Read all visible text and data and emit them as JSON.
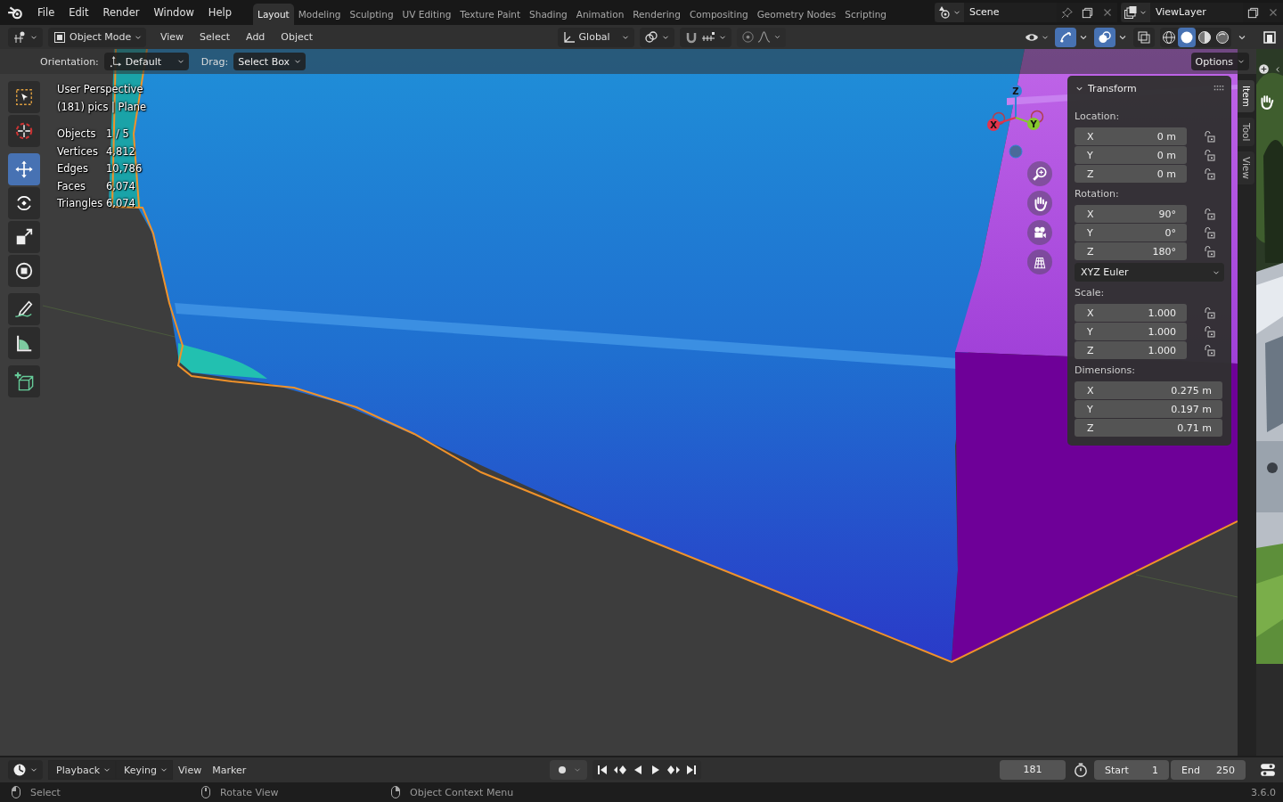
{
  "top_bar": {
    "menus": [
      "File",
      "Edit",
      "Render",
      "Window",
      "Help"
    ],
    "workspaces": [
      {
        "label": "Layout",
        "selected": true
      },
      {
        "label": "Modeling",
        "selected": false
      },
      {
        "label": "Sculpting",
        "selected": false
      },
      {
        "label": "UV Editing",
        "selected": false
      },
      {
        "label": "Texture Paint",
        "selected": false
      },
      {
        "label": "Shading",
        "selected": false
      },
      {
        "label": "Animation",
        "selected": false
      },
      {
        "label": "Rendering",
        "selected": false
      },
      {
        "label": "Compositing",
        "selected": false
      },
      {
        "label": "Geometry Nodes",
        "selected": false
      },
      {
        "label": "Scripting",
        "selected": false
      }
    ],
    "scene": "Scene",
    "view_layer": "ViewLayer"
  },
  "viewport_header": {
    "mode": "Object Mode",
    "menus": [
      "View",
      "Select",
      "Add",
      "Object"
    ],
    "transform_orientation": "Global",
    "toggles": [
      {
        "kind": "gizmos",
        "on": true
      },
      {
        "kind": "overlays",
        "on": true
      },
      {
        "kind": "xray",
        "on": false
      }
    ],
    "shading": [
      {
        "kind": "wireframe",
        "selected": false
      },
      {
        "kind": "solid",
        "selected": true
      },
      {
        "kind": "material",
        "selected": false
      },
      {
        "kind": "rendered",
        "selected": false
      }
    ]
  },
  "tool_settings": {
    "orientation_label": "Orientation:",
    "orientation": "Default",
    "drag_label": "Drag:",
    "drag": "Select Box",
    "options": "Options"
  },
  "toolbar": [
    {
      "tools": [
        {
          "kind": "select_box",
          "selected": false
        },
        {
          "kind": "cursor",
          "selected": false
        }
      ]
    },
    {
      "tools": [
        {
          "kind": "move",
          "selected": true
        },
        {
          "kind": "rotate",
          "selected": false
        },
        {
          "kind": "scale",
          "selected": false
        },
        {
          "kind": "transform",
          "selected": false
        }
      ]
    },
    {
      "tools": [
        {
          "kind": "annotate",
          "selected": false
        },
        {
          "kind": "measure",
          "selected": false
        }
      ]
    },
    {
      "tools": [
        {
          "kind": "add_cube",
          "selected": false
        }
      ]
    }
  ],
  "overlay_info": {
    "view": "User Perspective",
    "context": "(181) pics | Plane",
    "stats": [
      {
        "label": "Objects",
        "value": "1 / 5"
      },
      {
        "label": "Vertices",
        "value": "4,812"
      },
      {
        "label": "Edges",
        "value": "10,786"
      },
      {
        "label": "Faces",
        "value": "6,074"
      },
      {
        "label": "Triangles",
        "value": "6,074"
      }
    ]
  },
  "navigation_gizmo": {
    "axes": [
      {
        "label": "Z",
        "color": "#2f83d6"
      },
      {
        "label": "X",
        "color": "#e2344c"
      },
      {
        "label": "Y",
        "color": "#86c82e"
      }
    ],
    "buttons": [
      {
        "kind": "zoom"
      },
      {
        "kind": "pan"
      },
      {
        "kind": "camera"
      },
      {
        "kind": "ortho"
      }
    ]
  },
  "sidebar": {
    "tabs": [
      {
        "label": "Item",
        "selected": true
      },
      {
        "label": "Tool",
        "selected": false
      },
      {
        "label": "View",
        "selected": false
      }
    ],
    "panel": {
      "title": "Transform",
      "expanded": true,
      "sections": [
        {
          "kind": "fields",
          "label": "Location:",
          "locks": true,
          "fields": [
            {
              "axis": "X",
              "value": "0 m"
            },
            {
              "axis": "Y",
              "value": "0 m"
            },
            {
              "axis": "Z",
              "value": "0 m"
            }
          ]
        },
        {
          "kind": "fields",
          "label": "Rotation:",
          "locks": true,
          "fields": [
            {
              "axis": "X",
              "value": "90°"
            },
            {
              "axis": "Y",
              "value": "0°"
            },
            {
              "axis": "Z",
              "value": "180°"
            }
          ]
        },
        {
          "kind": "dropdown",
          "value": "XYZ Euler"
        },
        {
          "kind": "fields",
          "label": "Scale:",
          "locks": true,
          "fields": [
            {
              "axis": "X",
              "value": "1.000"
            },
            {
              "axis": "Y",
              "value": "1.000"
            },
            {
              "axis": "Z",
              "value": "1.000"
            }
          ]
        },
        {
          "kind": "fields",
          "label": "Dimensions:",
          "locks": false,
          "fields": [
            {
              "axis": "X",
              "value": "0.275 m"
            },
            {
              "axis": "Y",
              "value": "0.197 m"
            },
            {
              "axis": "Z",
              "value": "0.71 m"
            }
          ]
        }
      ]
    }
  },
  "timeline": {
    "menus": [
      {
        "label": "Playback",
        "dropdown": true
      },
      {
        "label": "Keying",
        "dropdown": true
      },
      {
        "label": "View",
        "dropdown": false
      },
      {
        "label": "Marker",
        "dropdown": false
      }
    ],
    "current_frame": "181",
    "start_label": "Start",
    "start": "1",
    "end_label": "End",
    "end": "250"
  },
  "status_bar": {
    "hints": [
      {
        "kind": "left",
        "text": "Select"
      },
      {
        "kind": "middle",
        "text": "Rotate View"
      },
      {
        "kind": "right",
        "text": "Object Context Menu"
      }
    ],
    "version": "3.6.0"
  }
}
